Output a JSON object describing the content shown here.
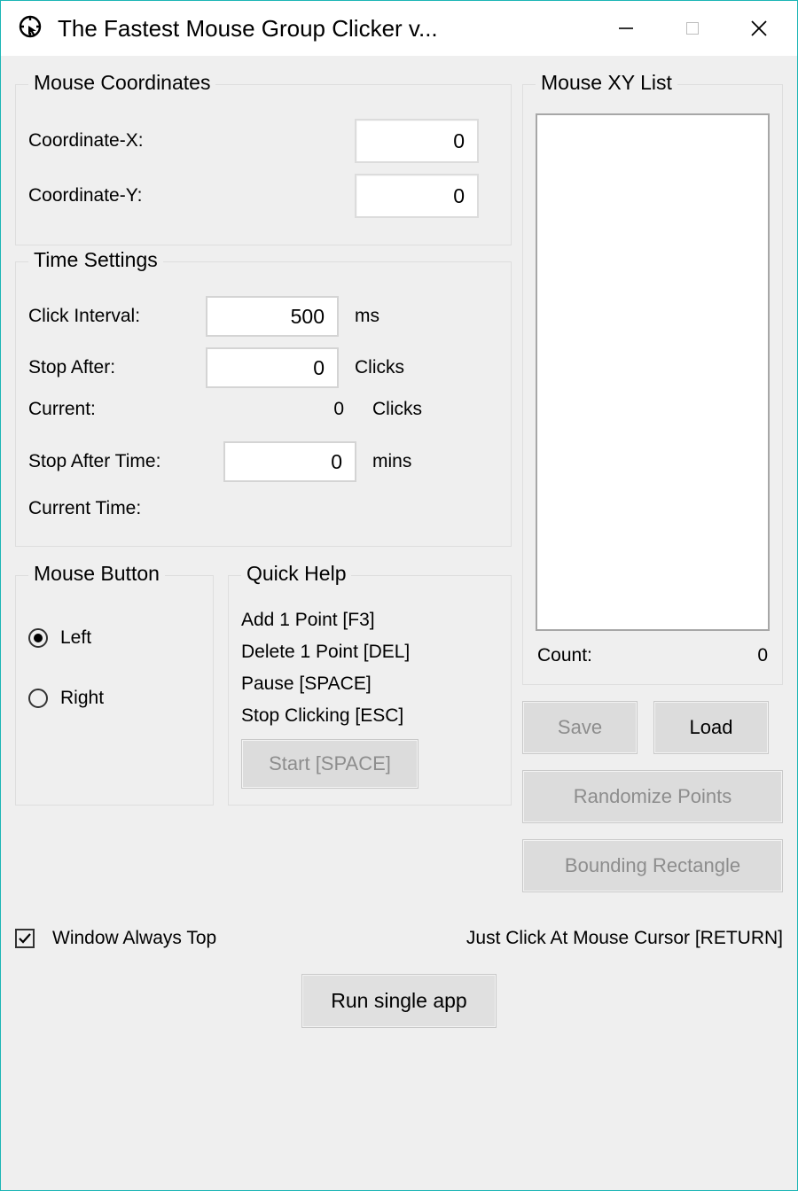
{
  "window": {
    "title": "The Fastest Mouse Group Clicker v..."
  },
  "coords": {
    "legend": "Mouse Coordinates",
    "x_label": "Coordinate-X:",
    "x_value": "0",
    "y_label": "Coordinate-Y:",
    "y_value": "0"
  },
  "time": {
    "legend": "Time Settings",
    "interval_label": "Click Interval:",
    "interval_value": "500",
    "interval_unit": "ms",
    "stop_after_label": "Stop After:",
    "stop_after_value": "0",
    "stop_after_unit": "Clicks",
    "current_label": "Current:",
    "current_value": "0",
    "current_unit": "Clicks",
    "stop_time_label": "Stop After Time:",
    "stop_time_value": "0",
    "stop_time_unit": "mins",
    "current_time_label": "Current Time:",
    "current_time_value": ""
  },
  "mouse_button": {
    "legend": "Mouse Button",
    "left": "Left",
    "right": "Right",
    "selected": "left"
  },
  "quick_help": {
    "legend": "Quick Help",
    "lines": {
      "add": "Add 1 Point [F3]",
      "delete": "Delete 1 Point [DEL]",
      "pause": "Pause [SPACE]",
      "stop": "Stop Clicking [ESC]"
    },
    "start_button": "Start [SPACE]"
  },
  "xy": {
    "legend": "Mouse XY List",
    "count_label": "Count:",
    "count_value": "0",
    "save": "Save",
    "load": "Load",
    "randomize": "Randomize Points",
    "bounding": "Bounding Rectangle"
  },
  "bottom": {
    "always_top": "Window Always Top",
    "always_top_checked": true,
    "cursor_hint": "Just Click At Mouse Cursor [RETURN]",
    "run": "Run single app"
  }
}
